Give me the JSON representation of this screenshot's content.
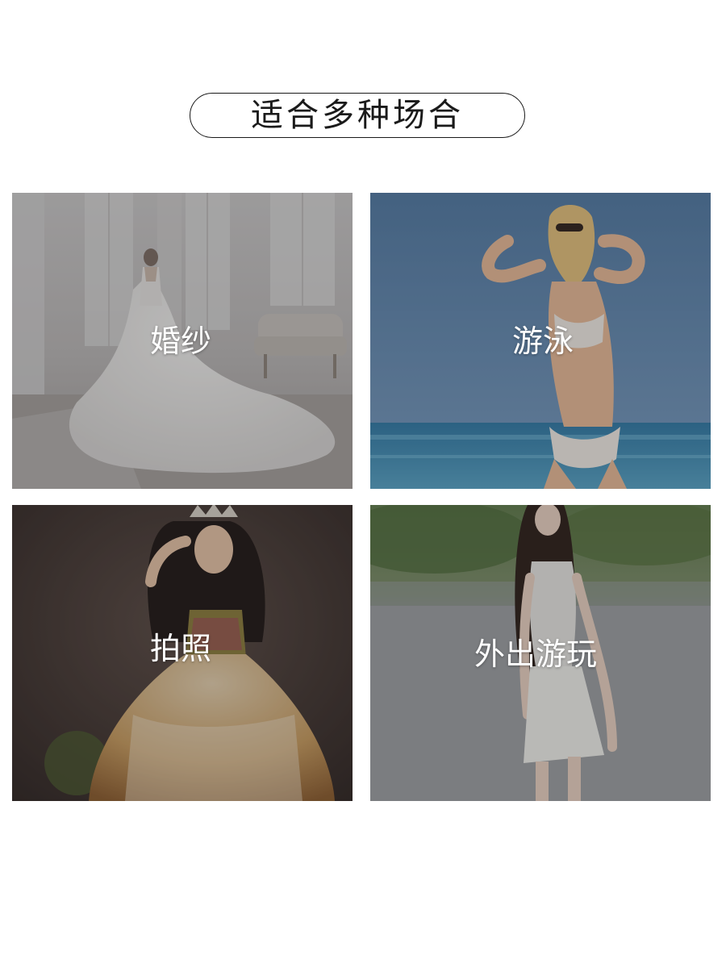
{
  "header": {
    "title": "适合多种场合"
  },
  "tiles": [
    {
      "label": "婚纱",
      "icon": "wedding-dress-photo"
    },
    {
      "label": "游泳",
      "icon": "swimwear-beach-photo"
    },
    {
      "label": "拍照",
      "icon": "photoshoot-gown-photo"
    },
    {
      "label": "外出游玩",
      "icon": "street-outing-photo"
    }
  ],
  "colors": {
    "title_border": "#1a1a1a",
    "label_text": "#ffffff"
  }
}
